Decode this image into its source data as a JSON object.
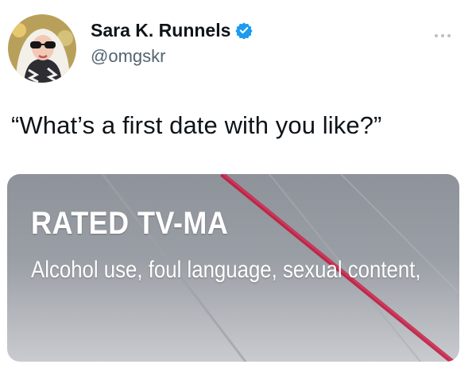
{
  "user": {
    "display_name": "Sara K. Runnels",
    "handle": "@omgskr",
    "verified": true,
    "avatar_icon": "profile-photo"
  },
  "tweet": {
    "text": "“What’s a first date with you like?”"
  },
  "media": {
    "rating": "RATED TV-MA",
    "descriptors": "Alcohol use, foul language, sexual content,"
  },
  "icons": {
    "verified": "verified-badge-icon",
    "more": "more-options-icon"
  },
  "colors": {
    "verified_badge": "#1d9bf0",
    "handle": "#536471",
    "media_streak": "#c0143c"
  }
}
